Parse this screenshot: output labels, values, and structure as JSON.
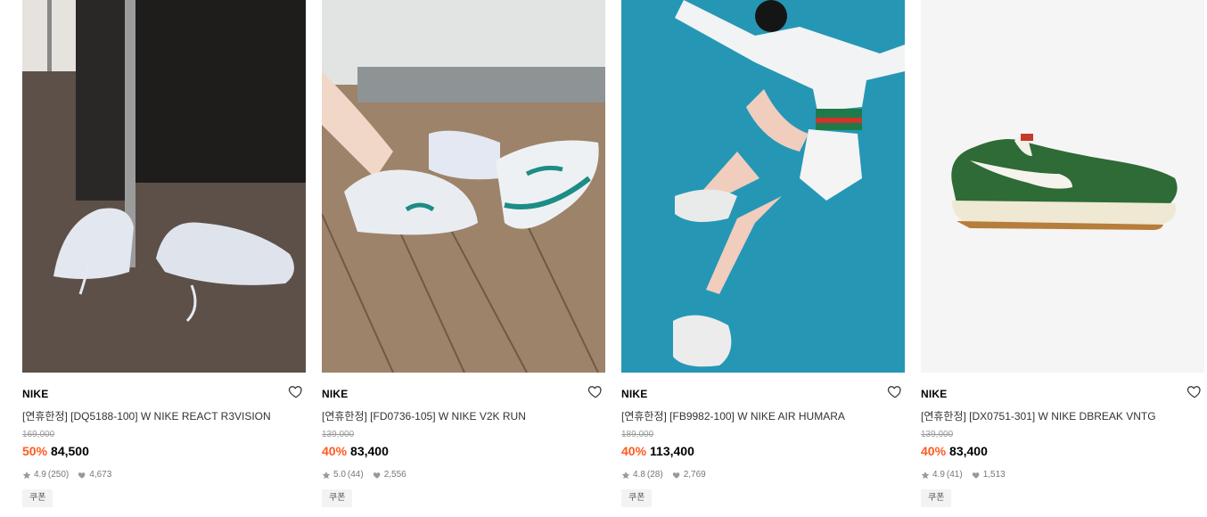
{
  "products": [
    {
      "brand": "NIKE",
      "title": "[연휴한정] [DQ5188-100] W NIKE REACT R3VISION",
      "original_price": "169,000",
      "discount": "50%",
      "price": "84,500",
      "rating": "4.9",
      "review_count": "(250)",
      "likes": "4,673",
      "coupon_label": "쿠폰"
    },
    {
      "brand": "NIKE",
      "title": "[연휴한정] [FD0736-105] W NIKE V2K RUN",
      "original_price": "139,000",
      "discount": "40%",
      "price": "83,400",
      "rating": "5.0",
      "review_count": "(44)",
      "likes": "2,556",
      "coupon_label": "쿠폰"
    },
    {
      "brand": "NIKE",
      "title": "[연휴한정] [FB9982-100] W NIKE AIR HUMARA",
      "original_price": "189,000",
      "discount": "40%",
      "price": "113,400",
      "rating": "4.8",
      "review_count": "(28)",
      "likes": "2,769",
      "coupon_label": "쿠폰"
    },
    {
      "brand": "NIKE",
      "title": "[연휴한정] [DX0751-301] W NIKE DBREAK VNTG",
      "original_price": "139,000",
      "discount": "40%",
      "price": "83,400",
      "rating": "4.9",
      "review_count": "(41)",
      "likes": "1,513",
      "coupon_label": "쿠폰"
    }
  ],
  "colors": {
    "discount": "#ff5a1f",
    "muted": "#999999",
    "coupon_bg": "#f3f3f3"
  },
  "icons": {
    "like": "heart-outline-icon",
    "rating": "star-icon",
    "likes_count": "heart-filled-icon"
  }
}
